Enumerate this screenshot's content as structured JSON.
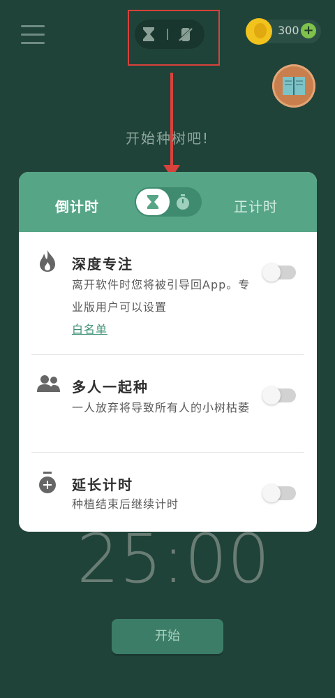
{
  "topbar": {
    "coins": "300"
  },
  "prompt": "开始种树吧!",
  "dialog": {
    "tab_countdown": "倒计时",
    "tab_countup": "正计时",
    "rows": [
      {
        "title": "深度专注",
        "desc": "离开软件时您将被引导回App。专业版用户可以设置",
        "link": "白名单",
        "enabled": false
      },
      {
        "title": "多人一起种",
        "desc": "一人放弃将导致所有人的小树枯萎",
        "enabled": false
      },
      {
        "title": "延长计时",
        "desc": "种植结束后继续计时",
        "enabled": false
      }
    ]
  },
  "timer": "25:00",
  "start_button": "开始",
  "colors": {
    "background": "#1f4339",
    "dialog_header": "#56a587",
    "annotation": "#d9423c",
    "coin": "#f2c31d"
  }
}
